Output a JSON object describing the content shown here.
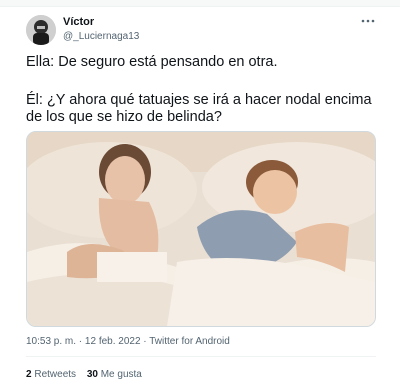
{
  "author": {
    "display_name": "Víctor",
    "handle": "@_Luciernaga13"
  },
  "icons": {
    "more": "more-horizontal-icon",
    "avatar": "avatar"
  },
  "tweet": {
    "line1": "Ella: De seguro está pensando en otra.",
    "line2": "Él: ¿Y ahora qué tatuajes se irá a hacer nodal encima",
    "line3": "de los que se hizo de belinda?"
  },
  "meta": {
    "time": "10:53 p. m.",
    "separator": " · ",
    "date": "12 feb. 2022",
    "source": "Twitter for Android"
  },
  "stats": {
    "retweets_count": "2",
    "retweets_label": "Retweets",
    "likes_count": "30",
    "likes_label": "Me gusta"
  },
  "colors": {
    "text": "#0f1419",
    "secondary": "#536471",
    "border": "#cfd9de"
  }
}
